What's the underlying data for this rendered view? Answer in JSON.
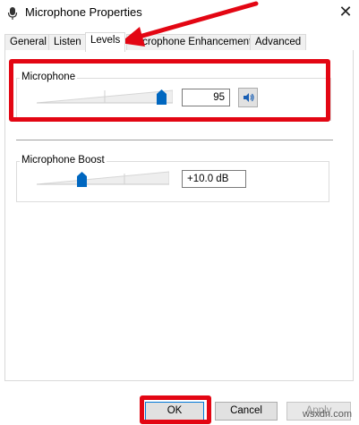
{
  "window": {
    "title": "Microphone Properties",
    "close_glyph": "✕"
  },
  "tabs": [
    {
      "label": "General",
      "active": false
    },
    {
      "label": "Listen",
      "active": false
    },
    {
      "label": "Levels",
      "active": true
    },
    {
      "label": "Microphone Enhancements",
      "active": false
    },
    {
      "label": "Advanced",
      "active": false
    }
  ],
  "levels": {
    "microphone": {
      "label": "Microphone",
      "value": "95",
      "level_percent": 95,
      "speaker_icon": "speaker-icon"
    },
    "boost": {
      "label": "Microphone Boost",
      "value": "+10.0 dB",
      "level_percent": 33
    }
  },
  "buttons": {
    "ok": "OK",
    "cancel": "Cancel",
    "apply": "Apply"
  },
  "watermark": "wsxdn.com",
  "colors": {
    "highlight": "#e30613",
    "slider_thumb": "#0067c0",
    "ok_border": "#0078d7"
  }
}
